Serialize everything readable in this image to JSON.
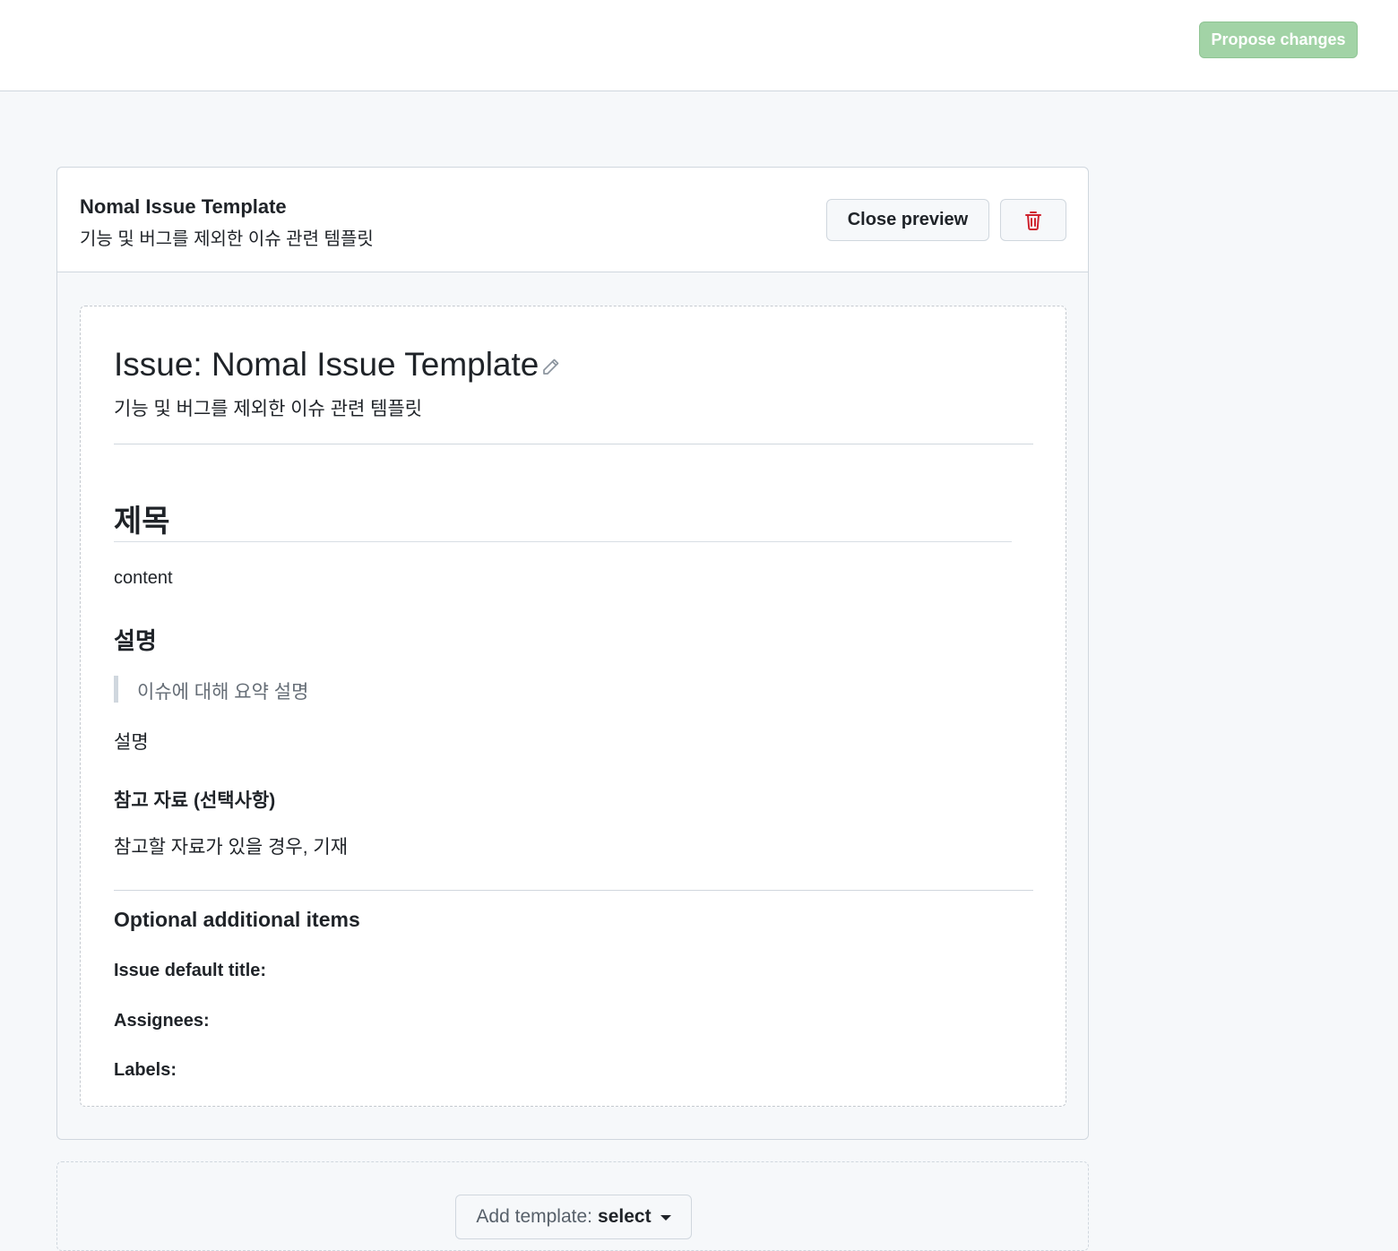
{
  "topbar": {
    "propose_label": "Propose changes"
  },
  "template": {
    "name": "Nomal Issue Template",
    "about": "기능 및 버그를 제외한 이슈 관련 템플릿",
    "close_preview_label": "Close preview",
    "delete_icon": "trash-icon"
  },
  "preview": {
    "title": "Issue: Nomal Issue Template",
    "edit_icon": "pencil-icon",
    "description": "기능 및 버그를 제외한 이슈 관련 템플릿",
    "body": {
      "heading_1": "제목",
      "content": "content",
      "heading_2": "설명",
      "blockquote": "이슈에 대해 요약 설명",
      "paragraph": "설명",
      "heading_3": "참고 자료 (선택사항)",
      "reference_text": "참고할 자료가 있을 경우, 기재"
    },
    "optional": {
      "title": "Optional additional items",
      "default_title_label": "Issue default title:",
      "assignees_label": "Assignees:",
      "labels_label": "Labels:"
    }
  },
  "add_template": {
    "label": "Add template:",
    "selected": "select"
  },
  "colors": {
    "propose_bg": "#a2d3a6",
    "danger": "#cf222e",
    "border": "#d0d7de"
  }
}
